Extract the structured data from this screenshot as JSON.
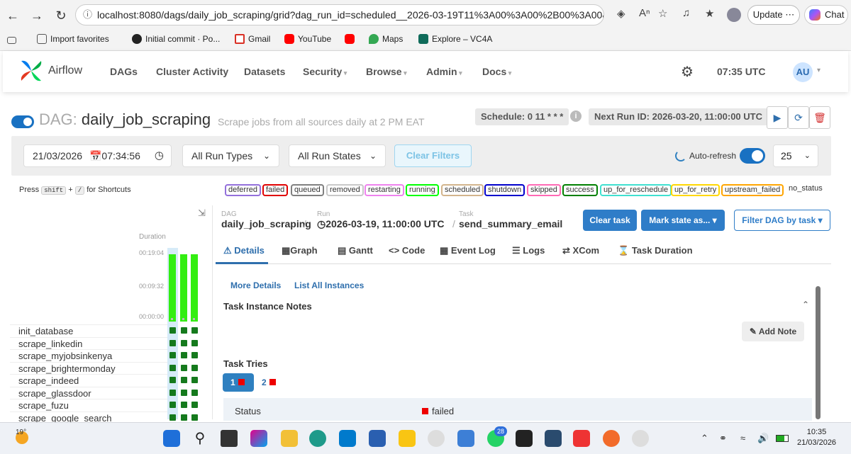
{
  "browser": {
    "url": "localhost:8080/dags/daily_job_scraping/grid?dag_run_id=scheduled__2026-03-19T11%3A00%3A00%2B00%3A00&task_i...",
    "update_label": "Update",
    "chat_label": "Chat",
    "bookmarks": [
      "Import favorites",
      "Initial commit · Po...",
      "Gmail",
      "YouTube",
      "Maps",
      "Explore – VC4A"
    ]
  },
  "nav": {
    "brand": "Airflow",
    "items": [
      "DAGs",
      "Cluster Activity",
      "Datasets",
      "Security",
      "Browse",
      "Admin",
      "Docs"
    ],
    "time": "07:35 UTC",
    "avatar": "AU"
  },
  "dag": {
    "label": "DAG:",
    "id": "daily_job_scraping",
    "description": "Scrape jobs from all sources daily at 2 PM EAT",
    "schedule": "Schedule: 0 11 * * *",
    "next_run": "Next Run ID: 2026-03-20, 11:00:00 UTC"
  },
  "filters": {
    "date": "21/03/2026",
    "time": "07:34:56",
    "run_types": "All Run Types",
    "run_states": "All Run States",
    "clear": "Clear Filters",
    "auto_refresh": "Auto-refresh",
    "page_size": "25"
  },
  "shortcuts": {
    "press": "Press",
    "k1": "shift",
    "plus": "+",
    "k2": "/",
    "rest": "for Shortcuts"
  },
  "states": [
    {
      "name": "deferred",
      "color": "#9370db"
    },
    {
      "name": "failed",
      "color": "#e00000"
    },
    {
      "name": "queued",
      "color": "#808080"
    },
    {
      "name": "removed",
      "color": "#c8c8c8"
    },
    {
      "name": "restarting",
      "color": "#ee82ee"
    },
    {
      "name": "running",
      "color": "#00ff00"
    },
    {
      "name": "scheduled",
      "color": "#d2b48c"
    },
    {
      "name": "shutdown",
      "color": "#0000cc"
    },
    {
      "name": "skipped",
      "color": "#ff69b4"
    },
    {
      "name": "success",
      "color": "#008000"
    },
    {
      "name": "up_for_reschedule",
      "color": "#40e0d0"
    },
    {
      "name": "up_for_retry",
      "color": "#ffd700"
    },
    {
      "name": "upstream_failed",
      "color": "#ffa500"
    },
    {
      "name": "no_status",
      "color": ""
    }
  ],
  "grid": {
    "duration_label": "Duration",
    "axis": [
      "00:19:04",
      "00:09:32",
      "00:00:00"
    ],
    "tasks": [
      "init_database",
      "scrape_linkedin",
      "scrape_myjobsinkenya",
      "scrape_brightermonday",
      "scrape_indeed",
      "scrape_glassdoor",
      "scrape_fuzu",
      "scrape_google_search"
    ]
  },
  "detail": {
    "crumb_labels": {
      "dag": "DAG",
      "run": "Run",
      "task": "Task"
    },
    "dag": "daily_job_scraping",
    "run": "2026-03-19, 11:00:00 UTC",
    "task": "send_summary_email",
    "clear_task": "Clear task",
    "mark_state": "Mark state as...",
    "filter_task": "Filter DAG by task",
    "tabs": [
      "Details",
      "Graph",
      "Gantt",
      "Code",
      "Event Log",
      "Logs",
      "XCom",
      "Task Duration"
    ],
    "more_details": "More Details",
    "list_instances": "List All Instances",
    "notes_title": "Task Instance Notes",
    "add_note": "Add Note",
    "tries_title": "Task Tries",
    "tries": [
      "1",
      "2"
    ],
    "status_label": "Status",
    "status_value": "failed"
  },
  "taskbar": {
    "temp": "19°",
    "time": "10:35",
    "date": "21/03/2026",
    "badge": "28"
  }
}
